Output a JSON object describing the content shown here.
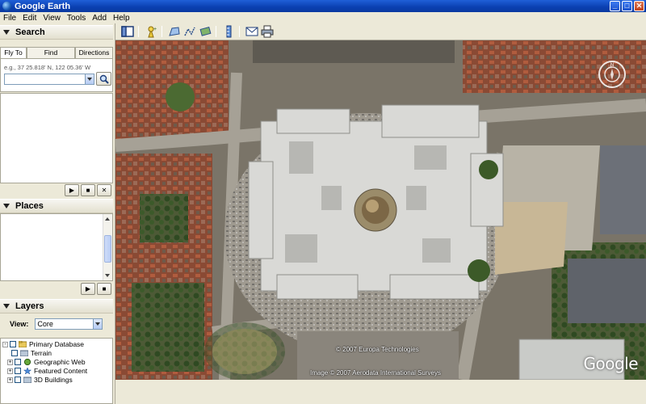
{
  "window": {
    "title": "Google Earth"
  },
  "menu": [
    "File",
    "Edit",
    "View",
    "Tools",
    "Add",
    "Help"
  ],
  "search": {
    "header": "Search",
    "tabs": [
      "Fly To",
      "Find Businesses",
      "Directions"
    ],
    "active_tab": "Fly To",
    "hint": "e.g., 37 25.818' N, 122 05.36' W",
    "input_value": "",
    "buttons": [
      "play",
      "stop",
      "clear"
    ]
  },
  "places": {
    "header": "Places"
  },
  "layers": {
    "header": "Layers",
    "view_label": "View:",
    "view_value": "Core",
    "items": [
      {
        "label": "Primary Database",
        "icon": "database-icon",
        "expand": "-"
      },
      {
        "label": "Terrain",
        "icon": "terrain-icon",
        "expand": ""
      },
      {
        "label": "Geographic Web",
        "icon": "globe-icon",
        "expand": "+"
      },
      {
        "label": "Featured Content",
        "icon": "star-icon",
        "expand": "+"
      },
      {
        "label": "3D Buildings",
        "icon": "building-icon",
        "expand": "+"
      }
    ]
  },
  "map": {
    "credits": [
      "© 2007 Europa Technologies",
      "Image © 2007 Aerodata International Surveys"
    ],
    "logo": "Google"
  },
  "colors": {
    "titlebar": "#0a3fb0",
    "chrome": "#ece9d8"
  }
}
